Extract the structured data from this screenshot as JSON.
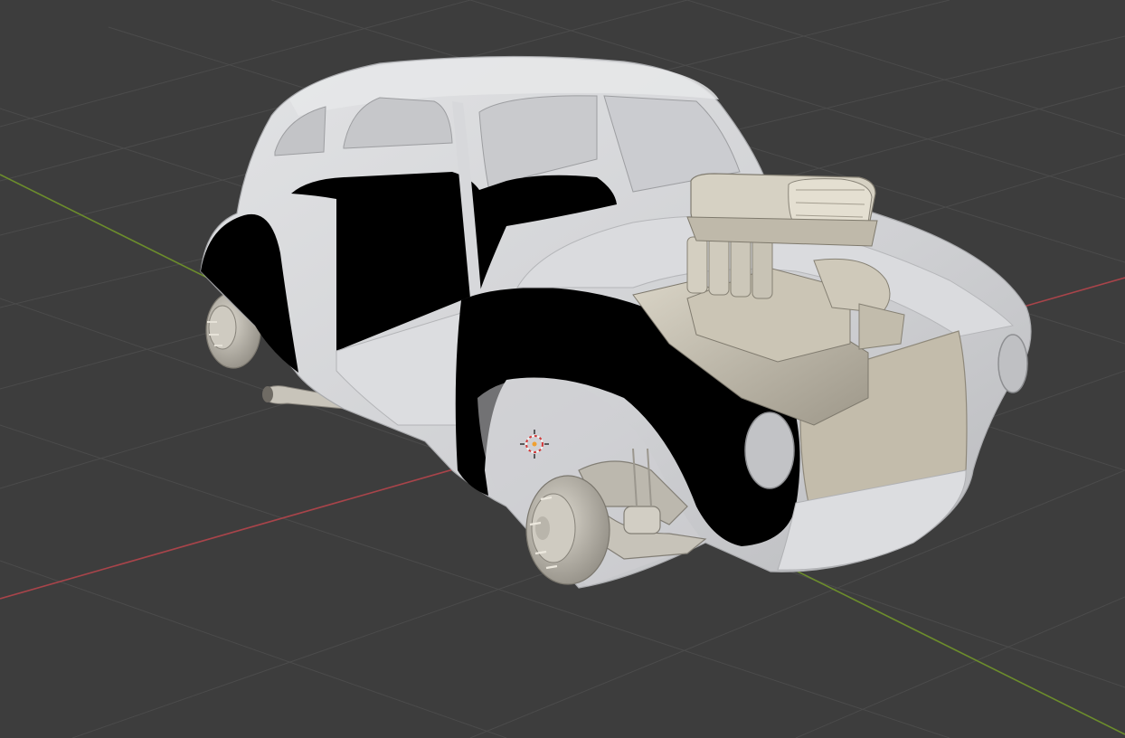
{
  "viewport": {
    "background_color": "#3d3d3d",
    "grid_line_color": "#4a4a4a",
    "x_axis_color": "#a8444a",
    "y_axis_color": "#6c8d2c",
    "shading": "solid"
  },
  "scene": {
    "objects": [
      {
        "id": "car-body",
        "material_color": "#d2d3d6"
      },
      {
        "id": "engine-blower",
        "material_color": "#bdb7a8"
      },
      {
        "id": "front-wheel-hub",
        "material_color": "#bab6ab"
      },
      {
        "id": "rear-wheel-hub",
        "material_color": "#bab6ab"
      },
      {
        "id": "exhaust-pipe",
        "material_color": "#c0bcb2"
      },
      {
        "id": "front-suspension",
        "material_color": "#b2ae a4"
      }
    ],
    "black_panel_color": "#000000",
    "origin_marker": "3d-cursor-icon"
  }
}
